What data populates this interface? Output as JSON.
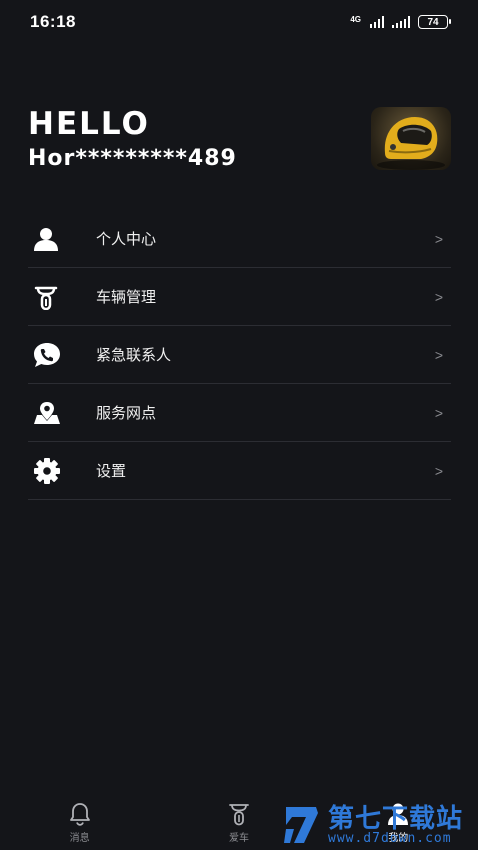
{
  "status_bar": {
    "time": "16:18",
    "network_label": "4G",
    "battery": "74"
  },
  "profile": {
    "greeting": "HELLO",
    "phone_masked": "Hor*********489",
    "avatar_icon": "helmet-avatar"
  },
  "menu": {
    "items": [
      {
        "label": "个人中心",
        "icon": "person-icon"
      },
      {
        "label": "车辆管理",
        "icon": "scooter-icon"
      },
      {
        "label": "紧急联系人",
        "icon": "phone-chat-icon"
      },
      {
        "label": "服务网点",
        "icon": "map-pin-icon"
      },
      {
        "label": "设置",
        "icon": "gear-icon"
      }
    ],
    "chevron": ">"
  },
  "tabbar": {
    "tabs": [
      {
        "label": "消息",
        "icon": "bell-icon"
      },
      {
        "label": "爱车",
        "icon": "scooter-icon"
      },
      {
        "label": "我的",
        "icon": "person-icon"
      }
    ],
    "active": "我的"
  },
  "watermark": {
    "title": "第七下载站",
    "url": "www.d7down.com"
  },
  "colors": {
    "background": "#141519",
    "divider": "#2c2d33",
    "muted": "#8a8b90",
    "watermark_blue": "#2f79d8"
  }
}
